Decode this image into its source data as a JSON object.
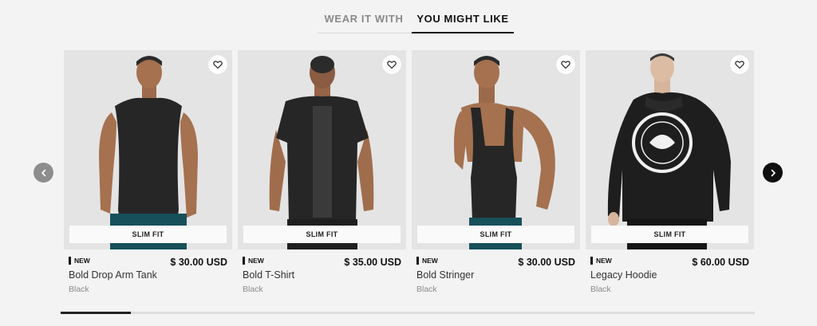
{
  "tabs": {
    "wear_it_with": "WEAR IT WITH",
    "you_might_like": "YOU MIGHT LIKE"
  },
  "carousel": {
    "prev_icon": "chevron-left-icon",
    "next_icon": "chevron-right-icon"
  },
  "products": [
    {
      "badge": "NEW",
      "price": "$ 30.00 USD",
      "name": "Bold Drop Arm Tank",
      "color": "Black",
      "fit": "SLIM FIT"
    },
    {
      "badge": "NEW",
      "price": "$ 35.00 USD",
      "name": "Bold T-Shirt",
      "color": "Black",
      "fit": "SLIM FIT"
    },
    {
      "badge": "NEW",
      "price": "$ 30.00 USD",
      "name": "Bold Stringer",
      "color": "Black",
      "fit": "SLIM FIT"
    },
    {
      "badge": "NEW",
      "price": "$ 60.00 USD",
      "name": "Legacy Hoodie",
      "color": "Black",
      "fit": "SLIM FIT"
    }
  ],
  "theme": {
    "background": "#f3f3f3",
    "card_background": "#e4e4e4",
    "accent": "#111111",
    "muted_text": "#8a8a8a"
  }
}
